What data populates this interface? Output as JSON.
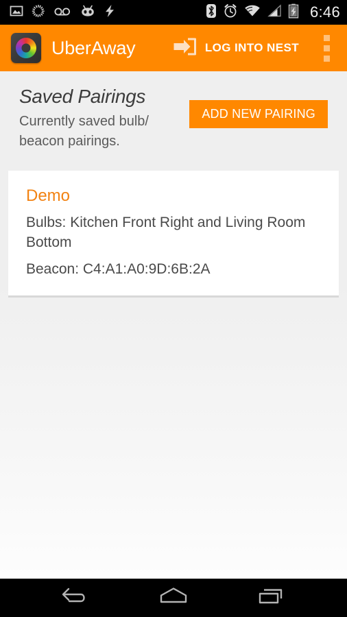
{
  "status_bar": {
    "time": "6:46",
    "left_icons": [
      {
        "name": "image-icon",
        "label": "Screenshot"
      },
      {
        "name": "sync-spinner-icon",
        "label": "Syncing"
      },
      {
        "name": "voicemail-icon",
        "label": "Voicemail"
      },
      {
        "name": "cyanogenmod-icon",
        "label": "CyanogenMod"
      },
      {
        "name": "charging-bolt-icon",
        "label": "Charging"
      }
    ],
    "right_icons": [
      {
        "name": "bluetooth-icon",
        "label": "Bluetooth"
      },
      {
        "name": "alarm-clock-icon",
        "label": "Alarm set"
      },
      {
        "name": "wifi-icon",
        "label": "Wi-Fi"
      },
      {
        "name": "cell-signal-icon",
        "label": "Cellular signal"
      },
      {
        "name": "battery-charging-icon",
        "label": "Battery charging"
      }
    ]
  },
  "app_bar": {
    "app_name": "UberAway",
    "app_icon_name": "color-wheel-app-icon",
    "nest_action_label": "LOG INTO NEST",
    "nest_action_icon": "login-arrow-icon",
    "overflow_icon": "overflow-menu-icon",
    "background_color": "#ff8800"
  },
  "page": {
    "title": "Saved Pairings",
    "subtitle": "Currently saved bulb/ beacon pairings.",
    "add_button_label": "ADD NEW PAIRING",
    "background_color": "#efefef",
    "accent_color": "#ff8800"
  },
  "pairings": [
    {
      "name": "Demo",
      "bulbs": "Bulbs: Kitchen Front Right and Living Room Bottom",
      "beacon": "Beacon: C4:A1:A0:9D:6B:2A",
      "title_color": "#f28212"
    }
  ],
  "nav_bar": {
    "buttons": [
      {
        "name": "back-button",
        "icon": "back-arrow-icon"
      },
      {
        "name": "home-button",
        "icon": "home-icon"
      },
      {
        "name": "recents-button",
        "icon": "recents-icon"
      }
    ]
  }
}
